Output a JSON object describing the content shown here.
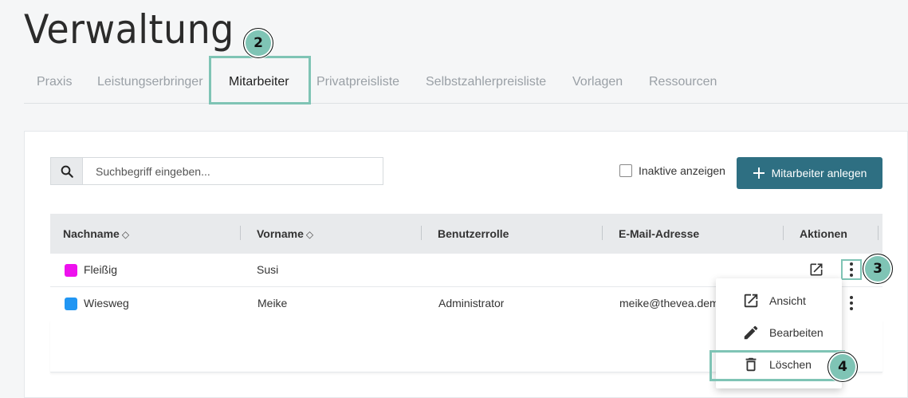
{
  "page": {
    "title": "Verwaltung"
  },
  "tabs": [
    {
      "label": "Praxis"
    },
    {
      "label": "Leistungserbringer"
    },
    {
      "label": "Mitarbeiter",
      "active": true
    },
    {
      "label": "Privatpreisliste"
    },
    {
      "label": "Selbstzahlerpreisliste"
    },
    {
      "label": "Vorlagen"
    },
    {
      "label": "Ressourcen"
    }
  ],
  "search": {
    "placeholder": "Suchbegriff eingeben...",
    "icon": "search-icon"
  },
  "filter": {
    "inactive_label": "Inaktive anzeigen",
    "checked": false
  },
  "add_button": {
    "label": "Mitarbeiter anlegen",
    "icon": "plus-icon",
    "color": "#2e6f82"
  },
  "table": {
    "headers": {
      "nachname": "Nachname",
      "vorname": "Vorname",
      "rolle": "Benutzerrolle",
      "email": "E-Mail-Adresse",
      "aktionen": "Aktionen"
    },
    "sort_glyph": "◇",
    "rows": [
      {
        "color": "#ee11ee",
        "nachname": "Fleißig",
        "vorname": "Susi",
        "rolle": "",
        "email": ""
      },
      {
        "color": "#2196f3",
        "nachname": "Wiesweg",
        "vorname": "Meike",
        "rolle": "Administrator",
        "email": "meike@thevea.dem"
      }
    ]
  },
  "context_menu": {
    "items": [
      {
        "label": "Ansicht",
        "icon": "open-external-icon"
      },
      {
        "label": "Bearbeiten",
        "icon": "pencil-icon"
      },
      {
        "label": "Löschen",
        "icon": "trash-icon"
      }
    ]
  },
  "annotations": {
    "highlight_color": "#7fc4b5",
    "steps": [
      "2",
      "3",
      "4"
    ]
  }
}
